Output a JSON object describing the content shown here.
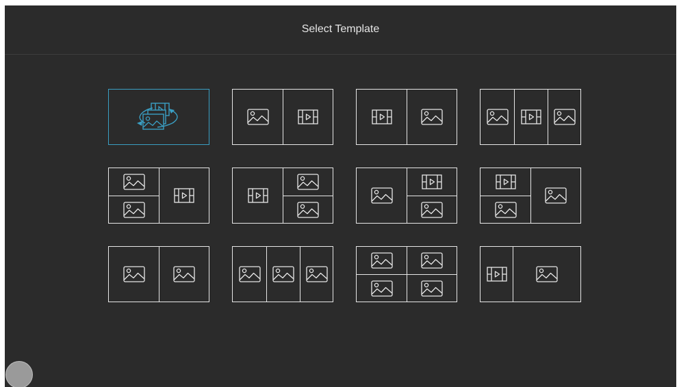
{
  "header": {
    "title": "Select Template"
  },
  "colors": {
    "background": "#2b2b2b",
    "line": "#e8e8e8",
    "accent": "#3a9fc4"
  },
  "templates": [
    {
      "name": "template-dynamic",
      "selected": true,
      "cells": [
        "dynamic"
      ]
    },
    {
      "name": "template-image-video",
      "selected": false,
      "cells": [
        "image",
        "video"
      ]
    },
    {
      "name": "template-video-image",
      "selected": false,
      "cells": [
        "video",
        "image"
      ]
    },
    {
      "name": "template-image-video-image",
      "selected": false,
      "cells": [
        "image",
        "video",
        "image"
      ]
    },
    {
      "name": "template-2images-video",
      "selected": false,
      "cells": [
        "image",
        "image",
        "video"
      ]
    },
    {
      "name": "template-video-2images",
      "selected": false,
      "cells": [
        "video",
        "image",
        "image"
      ]
    },
    {
      "name": "template-image-video-image-stack",
      "selected": false,
      "cells": [
        "image",
        "video",
        "image"
      ]
    },
    {
      "name": "template-video-image-stack-image",
      "selected": false,
      "cells": [
        "video",
        "image",
        "image"
      ]
    },
    {
      "name": "template-2images",
      "selected": false,
      "cells": [
        "image",
        "image"
      ]
    },
    {
      "name": "template-3images",
      "selected": false,
      "cells": [
        "image",
        "image",
        "image"
      ]
    },
    {
      "name": "template-4images",
      "selected": false,
      "cells": [
        "image",
        "image",
        "image",
        "image"
      ]
    },
    {
      "name": "template-video-wide-image",
      "selected": false,
      "cells": [
        "video",
        "image"
      ]
    }
  ],
  "icons": {
    "image": "image-icon",
    "video": "video-icon",
    "dynamic": "media-rotate-icon"
  },
  "floating_button": {
    "icon": "circle-button"
  }
}
